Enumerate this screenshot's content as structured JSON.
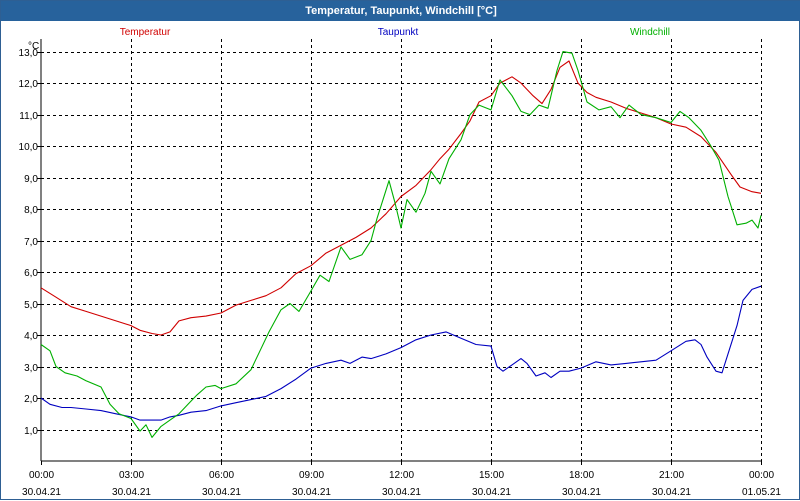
{
  "window": {
    "title": "Temperatur, Taupunkt, Windchill [°C]"
  },
  "chart_data": {
    "type": "line",
    "title": "Temperatur, Taupunkt, Windchill [°C]",
    "ylabel": "°C",
    "xlabel": "",
    "ylim": [
      0,
      13.4
    ],
    "yticks": [
      {
        "value": 1,
        "label": "1,0"
      },
      {
        "value": 2,
        "label": "2,0"
      },
      {
        "value": 3,
        "label": "3,0"
      },
      {
        "value": 4,
        "label": "4,0"
      },
      {
        "value": 5,
        "label": "5,0"
      },
      {
        "value": 6,
        "label": "6,0"
      },
      {
        "value": 7,
        "label": "7,0"
      },
      {
        "value": 8,
        "label": "8,0"
      },
      {
        "value": 9,
        "label": "9,0"
      },
      {
        "value": 10,
        "label": "10,0"
      },
      {
        "value": 11,
        "label": "11,0"
      },
      {
        "value": 12,
        "label": "12,0"
      },
      {
        "value": 13,
        "label": "13,0"
      }
    ],
    "xlim": [
      0,
      24
    ],
    "xticks": [
      {
        "hour": 0,
        "time": "00:00",
        "date": "30.04.21"
      },
      {
        "hour": 3,
        "time": "03:00",
        "date": "30.04.21"
      },
      {
        "hour": 6,
        "time": "06:00",
        "date": "30.04.21"
      },
      {
        "hour": 9,
        "time": "09:00",
        "date": "30.04.21"
      },
      {
        "hour": 12,
        "time": "12:00",
        "date": "30.04.21"
      },
      {
        "hour": 15,
        "time": "15:00",
        "date": "30.04.21"
      },
      {
        "hour": 18,
        "time": "18:00",
        "date": "30.04.21"
      },
      {
        "hour": 21,
        "time": "21:00",
        "date": "30.04.21"
      },
      {
        "hour": 24,
        "time": "00:00",
        "date": "01.05.21"
      }
    ],
    "grid": true,
    "legend_position": "top",
    "series": [
      {
        "name": "Temperatur",
        "color": "#d00000",
        "points": [
          [
            0,
            5.5
          ],
          [
            0.5,
            5.2
          ],
          [
            1,
            4.9
          ],
          [
            1.5,
            4.75
          ],
          [
            2,
            4.6
          ],
          [
            2.5,
            4.45
          ],
          [
            3,
            4.3
          ],
          [
            3.3,
            4.15
          ],
          [
            3.7,
            4.05
          ],
          [
            4,
            4.0
          ],
          [
            4.3,
            4.1
          ],
          [
            4.6,
            4.45
          ],
          [
            5,
            4.55
          ],
          [
            5.5,
            4.6
          ],
          [
            6,
            4.7
          ],
          [
            6.5,
            4.95
          ],
          [
            7,
            5.1
          ],
          [
            7.5,
            5.25
          ],
          [
            8,
            5.5
          ],
          [
            8.5,
            5.95
          ],
          [
            9,
            6.2
          ],
          [
            9.5,
            6.6
          ],
          [
            10,
            6.85
          ],
          [
            10.5,
            7.1
          ],
          [
            11,
            7.4
          ],
          [
            11.5,
            7.85
          ],
          [
            12,
            8.4
          ],
          [
            12.5,
            8.75
          ],
          [
            13,
            9.25
          ],
          [
            13.3,
            9.6
          ],
          [
            13.6,
            9.9
          ],
          [
            14,
            10.4
          ],
          [
            14.3,
            10.8
          ],
          [
            14.6,
            11.4
          ],
          [
            15,
            11.6
          ],
          [
            15.3,
            12.0
          ],
          [
            15.7,
            12.2
          ],
          [
            16,
            12.0
          ],
          [
            16.4,
            11.6
          ],
          [
            16.7,
            11.35
          ],
          [
            17,
            11.8
          ],
          [
            17.3,
            12.5
          ],
          [
            17.6,
            12.7
          ],
          [
            17.9,
            12.0
          ],
          [
            18.2,
            11.7
          ],
          [
            18.5,
            11.55
          ],
          [
            19,
            11.4
          ],
          [
            19.5,
            11.2
          ],
          [
            20,
            11.05
          ],
          [
            20.5,
            10.9
          ],
          [
            21,
            10.7
          ],
          [
            21.5,
            10.6
          ],
          [
            22,
            10.3
          ],
          [
            22.5,
            9.8
          ],
          [
            23,
            9.1
          ],
          [
            23.3,
            8.7
          ],
          [
            23.7,
            8.55
          ],
          [
            24,
            8.5
          ]
        ]
      },
      {
        "name": "Taupunkt",
        "color": "#0000c0",
        "points": [
          [
            0,
            2.0
          ],
          [
            0.3,
            1.8
          ],
          [
            0.7,
            1.7
          ],
          [
            1,
            1.7
          ],
          [
            1.5,
            1.65
          ],
          [
            2,
            1.6
          ],
          [
            2.5,
            1.5
          ],
          [
            3,
            1.4
          ],
          [
            3.3,
            1.3
          ],
          [
            3.7,
            1.3
          ],
          [
            4,
            1.3
          ],
          [
            4.3,
            1.4
          ],
          [
            4.6,
            1.45
          ],
          [
            5,
            1.55
          ],
          [
            5.5,
            1.6
          ],
          [
            6,
            1.75
          ],
          [
            6.5,
            1.85
          ],
          [
            7,
            1.95
          ],
          [
            7.5,
            2.05
          ],
          [
            8,
            2.3
          ],
          [
            8.5,
            2.6
          ],
          [
            9,
            2.95
          ],
          [
            9.5,
            3.1
          ],
          [
            10,
            3.2
          ],
          [
            10.3,
            3.1
          ],
          [
            10.7,
            3.3
          ],
          [
            11,
            3.25
          ],
          [
            11.5,
            3.4
          ],
          [
            12,
            3.6
          ],
          [
            12.5,
            3.85
          ],
          [
            13,
            4.0
          ],
          [
            13.5,
            4.1
          ],
          [
            14,
            3.9
          ],
          [
            14.5,
            3.7
          ],
          [
            15,
            3.65
          ],
          [
            15.2,
            3.0
          ],
          [
            15.4,
            2.85
          ],
          [
            15.7,
            3.05
          ],
          [
            16,
            3.25
          ],
          [
            16.2,
            3.1
          ],
          [
            16.5,
            2.7
          ],
          [
            16.8,
            2.8
          ],
          [
            17,
            2.65
          ],
          [
            17.3,
            2.85
          ],
          [
            17.6,
            2.85
          ],
          [
            18,
            2.95
          ],
          [
            18.5,
            3.15
          ],
          [
            19,
            3.05
          ],
          [
            19.5,
            3.1
          ],
          [
            20,
            3.15
          ],
          [
            20.5,
            3.2
          ],
          [
            21,
            3.5
          ],
          [
            21.5,
            3.8
          ],
          [
            21.8,
            3.85
          ],
          [
            22,
            3.7
          ],
          [
            22.2,
            3.3
          ],
          [
            22.5,
            2.85
          ],
          [
            22.7,
            2.8
          ],
          [
            22.9,
            3.4
          ],
          [
            23.2,
            4.3
          ],
          [
            23.4,
            5.1
          ],
          [
            23.7,
            5.45
          ],
          [
            24,
            5.55
          ]
        ]
      },
      {
        "name": "Windchill",
        "color": "#00b000",
        "points": [
          [
            0,
            3.7
          ],
          [
            0.3,
            3.5
          ],
          [
            0.5,
            3.0
          ],
          [
            0.8,
            2.8
          ],
          [
            1.2,
            2.7
          ],
          [
            1.5,
            2.55
          ],
          [
            2,
            2.35
          ],
          [
            2.3,
            1.8
          ],
          [
            2.6,
            1.5
          ],
          [
            3,
            1.35
          ],
          [
            3.3,
            0.95
          ],
          [
            3.5,
            1.15
          ],
          [
            3.7,
            0.75
          ],
          [
            4,
            1.1
          ],
          [
            4.3,
            1.3
          ],
          [
            4.6,
            1.5
          ],
          [
            4.9,
            1.8
          ],
          [
            5.2,
            2.1
          ],
          [
            5.5,
            2.35
          ],
          [
            5.8,
            2.4
          ],
          [
            6,
            2.3
          ],
          [
            6.5,
            2.45
          ],
          [
            7,
            2.9
          ],
          [
            7.3,
            3.5
          ],
          [
            7.6,
            4.1
          ],
          [
            8,
            4.8
          ],
          [
            8.3,
            5.0
          ],
          [
            8.6,
            4.75
          ],
          [
            9,
            5.4
          ],
          [
            9.3,
            5.9
          ],
          [
            9.6,
            5.7
          ],
          [
            10,
            6.8
          ],
          [
            10.3,
            6.4
          ],
          [
            10.7,
            6.55
          ],
          [
            11,
            7.0
          ],
          [
            11.2,
            7.7
          ],
          [
            11.5,
            8.6
          ],
          [
            11.6,
            8.9
          ],
          [
            11.8,
            8.2
          ],
          [
            12,
            7.4
          ],
          [
            12.2,
            8.3
          ],
          [
            12.5,
            7.9
          ],
          [
            12.8,
            8.5
          ],
          [
            13,
            9.2
          ],
          [
            13.3,
            8.8
          ],
          [
            13.6,
            9.6
          ],
          [
            14,
            10.2
          ],
          [
            14.3,
            11.0
          ],
          [
            14.6,
            11.3
          ],
          [
            15,
            11.15
          ],
          [
            15.3,
            12.1
          ],
          [
            15.5,
            11.85
          ],
          [
            15.7,
            11.6
          ],
          [
            16,
            11.1
          ],
          [
            16.3,
            11.0
          ],
          [
            16.6,
            11.3
          ],
          [
            16.9,
            11.2
          ],
          [
            17.2,
            12.4
          ],
          [
            17.4,
            13.0
          ],
          [
            17.7,
            12.95
          ],
          [
            17.9,
            12.4
          ],
          [
            18.2,
            11.4
          ],
          [
            18.6,
            11.15
          ],
          [
            19,
            11.25
          ],
          [
            19.3,
            10.9
          ],
          [
            19.6,
            11.3
          ],
          [
            20,
            11.0
          ],
          [
            20.5,
            10.9
          ],
          [
            21,
            10.75
          ],
          [
            21.3,
            11.1
          ],
          [
            21.6,
            10.9
          ],
          [
            22,
            10.5
          ],
          [
            22.3,
            10.05
          ],
          [
            22.6,
            9.55
          ],
          [
            22.9,
            8.4
          ],
          [
            23.2,
            7.5
          ],
          [
            23.5,
            7.55
          ],
          [
            23.7,
            7.65
          ],
          [
            23.9,
            7.4
          ],
          [
            24,
            7.8
          ]
        ]
      }
    ]
  }
}
